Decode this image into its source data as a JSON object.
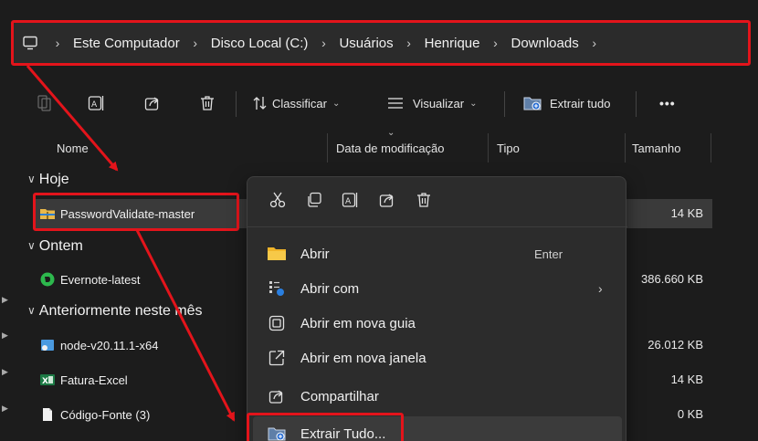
{
  "breadcrumb": {
    "items": [
      "Este Computador",
      "Disco Local (C:)",
      "Usuários",
      "Henrique",
      "Downloads"
    ]
  },
  "toolbar": {
    "sort_label": "Classificar",
    "view_label": "Visualizar",
    "extract_all_label": "Extrair tudo",
    "more_label": "•••"
  },
  "columns": {
    "name": "Nome",
    "modified": "Data de modificação",
    "type": "Tipo",
    "size": "Tamanho"
  },
  "groups": {
    "today": "Hoje",
    "yesterday": "Ontem",
    "earlier_month": "Anteriormente neste mês"
  },
  "files": {
    "password_validate": {
      "name": "PasswordValidate-master",
      "size": "14 KB"
    },
    "evernote": {
      "name": "Evernote-latest",
      "size": "386.660 KB"
    },
    "node": {
      "name": "node-v20.11.1-x64",
      "size": "26.012 KB"
    },
    "fatura": {
      "name": "Fatura-Excel",
      "size": "14 KB"
    },
    "codigo": {
      "name": "Código-Fonte (3)",
      "size": "0 KB"
    }
  },
  "context_menu": {
    "open": "Abrir",
    "open_shortcut": "Enter",
    "open_with": "Abrir com",
    "open_new_tab": "Abrir em nova guia",
    "open_new_window": "Abrir em nova janela",
    "share": "Compartilhar",
    "extract_all": "Extrair Tudo..."
  },
  "colors": {
    "highlight": "#e3141b",
    "background": "#1c1c1c",
    "menu": "#2c2c2c"
  }
}
